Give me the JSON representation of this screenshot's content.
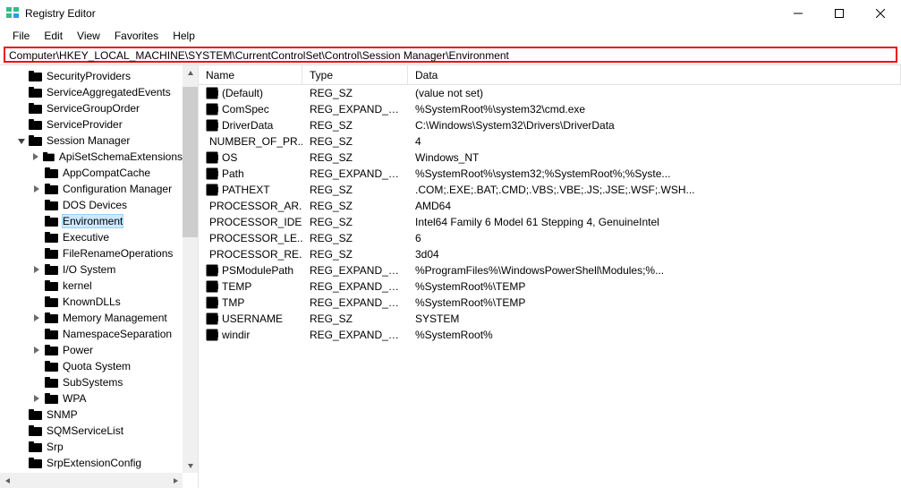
{
  "window": {
    "title": "Registry Editor"
  },
  "menu": {
    "file": "File",
    "edit": "Edit",
    "view": "View",
    "favorites": "Favorites",
    "help": "Help"
  },
  "address": "Computer\\HKEY_LOCAL_MACHINE\\SYSTEM\\CurrentControlSet\\Control\\Session Manager\\Environment",
  "tree": [
    {
      "depth": 1,
      "exp": "",
      "label": "SecurityProviders"
    },
    {
      "depth": 1,
      "exp": "",
      "label": "ServiceAggregatedEvents"
    },
    {
      "depth": 1,
      "exp": "",
      "label": "ServiceGroupOrder"
    },
    {
      "depth": 1,
      "exp": "",
      "label": "ServiceProvider"
    },
    {
      "depth": 1,
      "exp": "open",
      "label": "Session Manager"
    },
    {
      "depth": 2,
      "exp": "closed",
      "label": "ApiSetSchemaExtensions"
    },
    {
      "depth": 2,
      "exp": "",
      "label": "AppCompatCache"
    },
    {
      "depth": 2,
      "exp": "closed",
      "label": "Configuration Manager"
    },
    {
      "depth": 2,
      "exp": "",
      "label": "DOS Devices"
    },
    {
      "depth": 2,
      "exp": "",
      "label": "Environment",
      "selected": true
    },
    {
      "depth": 2,
      "exp": "",
      "label": "Executive"
    },
    {
      "depth": 2,
      "exp": "",
      "label": "FileRenameOperations"
    },
    {
      "depth": 2,
      "exp": "closed",
      "label": "I/O System"
    },
    {
      "depth": 2,
      "exp": "",
      "label": "kernel"
    },
    {
      "depth": 2,
      "exp": "",
      "label": "KnownDLLs"
    },
    {
      "depth": 2,
      "exp": "closed",
      "label": "Memory Management"
    },
    {
      "depth": 2,
      "exp": "",
      "label": "NamespaceSeparation"
    },
    {
      "depth": 2,
      "exp": "closed",
      "label": "Power"
    },
    {
      "depth": 2,
      "exp": "",
      "label": "Quota System"
    },
    {
      "depth": 2,
      "exp": "",
      "label": "SubSystems"
    },
    {
      "depth": 2,
      "exp": "closed",
      "label": "WPA"
    },
    {
      "depth": 1,
      "exp": "",
      "label": "SNMP"
    },
    {
      "depth": 1,
      "exp": "",
      "label": "SQMServiceList"
    },
    {
      "depth": 1,
      "exp": "",
      "label": "Srp"
    },
    {
      "depth": 1,
      "exp": "",
      "label": "SrpExtensionConfig"
    }
  ],
  "columns": {
    "name": "Name",
    "type": "Type",
    "data": "Data"
  },
  "values": [
    {
      "name": "(Default)",
      "type": "REG_SZ",
      "data": "(value not set)"
    },
    {
      "name": "ComSpec",
      "type": "REG_EXPAND_SZ",
      "data": "%SystemRoot%\\system32\\cmd.exe"
    },
    {
      "name": "DriverData",
      "type": "REG_SZ",
      "data": "C:\\Windows\\System32\\Drivers\\DriverData"
    },
    {
      "name": "NUMBER_OF_PR...",
      "type": "REG_SZ",
      "data": "4"
    },
    {
      "name": "OS",
      "type": "REG_SZ",
      "data": "Windows_NT"
    },
    {
      "name": "Path",
      "type": "REG_EXPAND_SZ",
      "data": "%SystemRoot%\\system32;%SystemRoot%;%Syste..."
    },
    {
      "name": "PATHEXT",
      "type": "REG_SZ",
      "data": ".COM;.EXE;.BAT;.CMD;.VBS;.VBE;.JS;.JSE;.WSF;.WSH..."
    },
    {
      "name": "PROCESSOR_AR...",
      "type": "REG_SZ",
      "data": "AMD64"
    },
    {
      "name": "PROCESSOR_IDE...",
      "type": "REG_SZ",
      "data": "Intel64 Family 6 Model 61 Stepping 4, GenuineIntel"
    },
    {
      "name": "PROCESSOR_LE...",
      "type": "REG_SZ",
      "data": "6"
    },
    {
      "name": "PROCESSOR_RE...",
      "type": "REG_SZ",
      "data": "3d04"
    },
    {
      "name": "PSModulePath",
      "type": "REG_EXPAND_SZ",
      "data": "%ProgramFiles%\\WindowsPowerShell\\Modules;%..."
    },
    {
      "name": "TEMP",
      "type": "REG_EXPAND_SZ",
      "data": "%SystemRoot%\\TEMP"
    },
    {
      "name": "TMP",
      "type": "REG_EXPAND_SZ",
      "data": "%SystemRoot%\\TEMP"
    },
    {
      "name": "USERNAME",
      "type": "REG_SZ",
      "data": "SYSTEM"
    },
    {
      "name": "windir",
      "type": "REG_EXPAND_SZ",
      "data": "%SystemRoot%"
    }
  ]
}
